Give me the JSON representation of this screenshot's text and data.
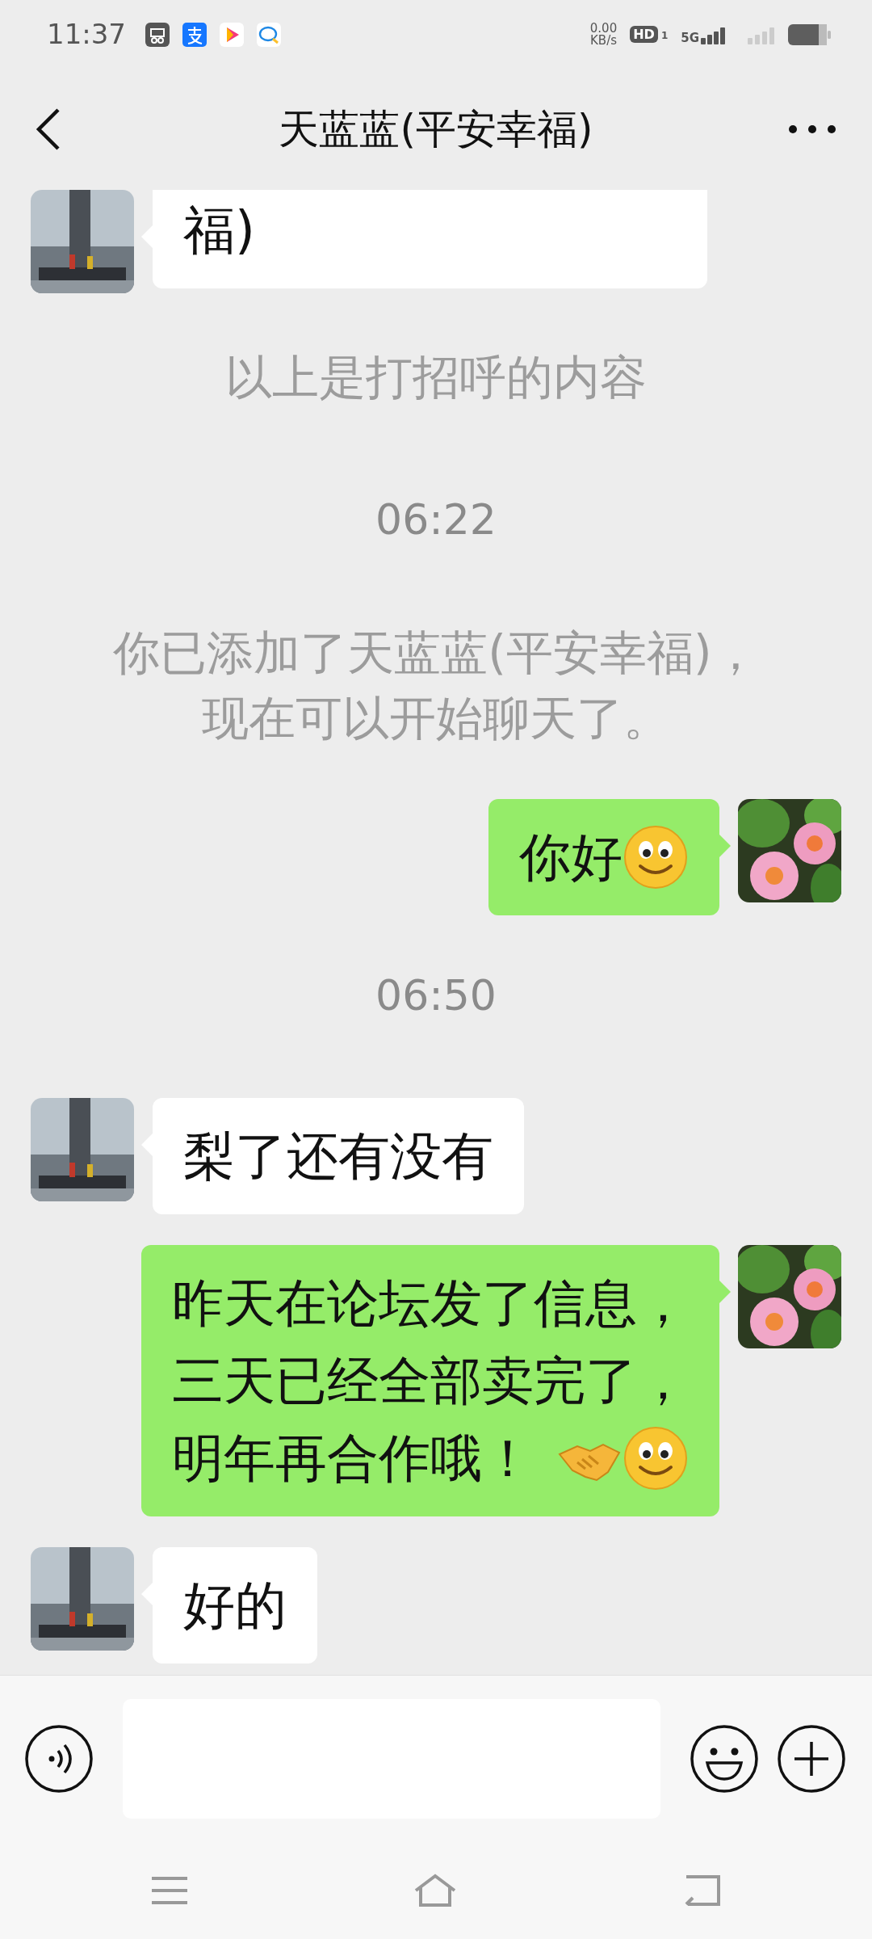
{
  "status_bar": {
    "time": "11:37",
    "net_speed": "0.00",
    "net_unit": "KB/s",
    "hd": "HD",
    "sim": "1",
    "network": "5G"
  },
  "header": {
    "title": "天蓝蓝(平安幸福)"
  },
  "messages": [
    {
      "kind": "incoming",
      "lines": [
        "福)"
      ],
      "cut_top": true
    },
    {
      "kind": "system",
      "lines": [
        "以上是打招呼的内容"
      ]
    },
    {
      "kind": "time",
      "lines": [
        "06:22"
      ]
    },
    {
      "kind": "system",
      "lines": [
        "你已添加了天蓝蓝(平安幸福)，",
        "现在可以开始聊天了。"
      ]
    },
    {
      "kind": "outgoing",
      "lines": [
        "你好"
      ],
      "emojis": [
        {
          "kind": "smile"
        }
      ]
    },
    {
      "kind": "time",
      "lines": [
        "06:50"
      ]
    },
    {
      "kind": "incoming",
      "lines": [
        "梨了还有没有"
      ]
    },
    {
      "kind": "outgoing",
      "lines": [
        "昨天在论坛发了信息，",
        "三天已经全部卖完了，",
        "明年再合作哦！"
      ],
      "emojis": [
        {
          "kind": "handshake"
        },
        {
          "kind": "smile"
        }
      ]
    },
    {
      "kind": "incoming",
      "lines": [
        "好的"
      ]
    }
  ]
}
